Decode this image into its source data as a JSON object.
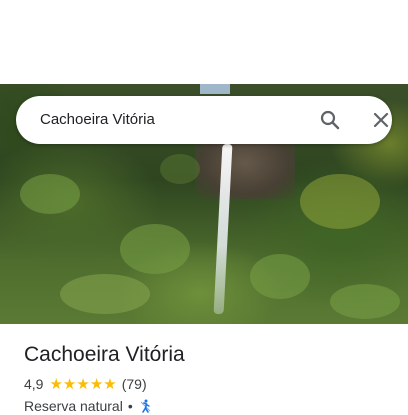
{
  "search": {
    "query": "Cachoeira Vitória"
  },
  "place": {
    "title": "Cachoeira Vitória",
    "rating": "4,9",
    "rating_value": 4.9,
    "stars": [
      "★",
      "★",
      "★",
      "★",
      "★"
    ],
    "review_count": "(79)",
    "category": "Reserva natural",
    "separator": "•",
    "category_icon": "hiking-icon"
  },
  "colors": {
    "star": "#fbbc04",
    "title_text": "#202124",
    "secondary_text": "#3c4043",
    "accent_blue": "#1a73e8"
  }
}
